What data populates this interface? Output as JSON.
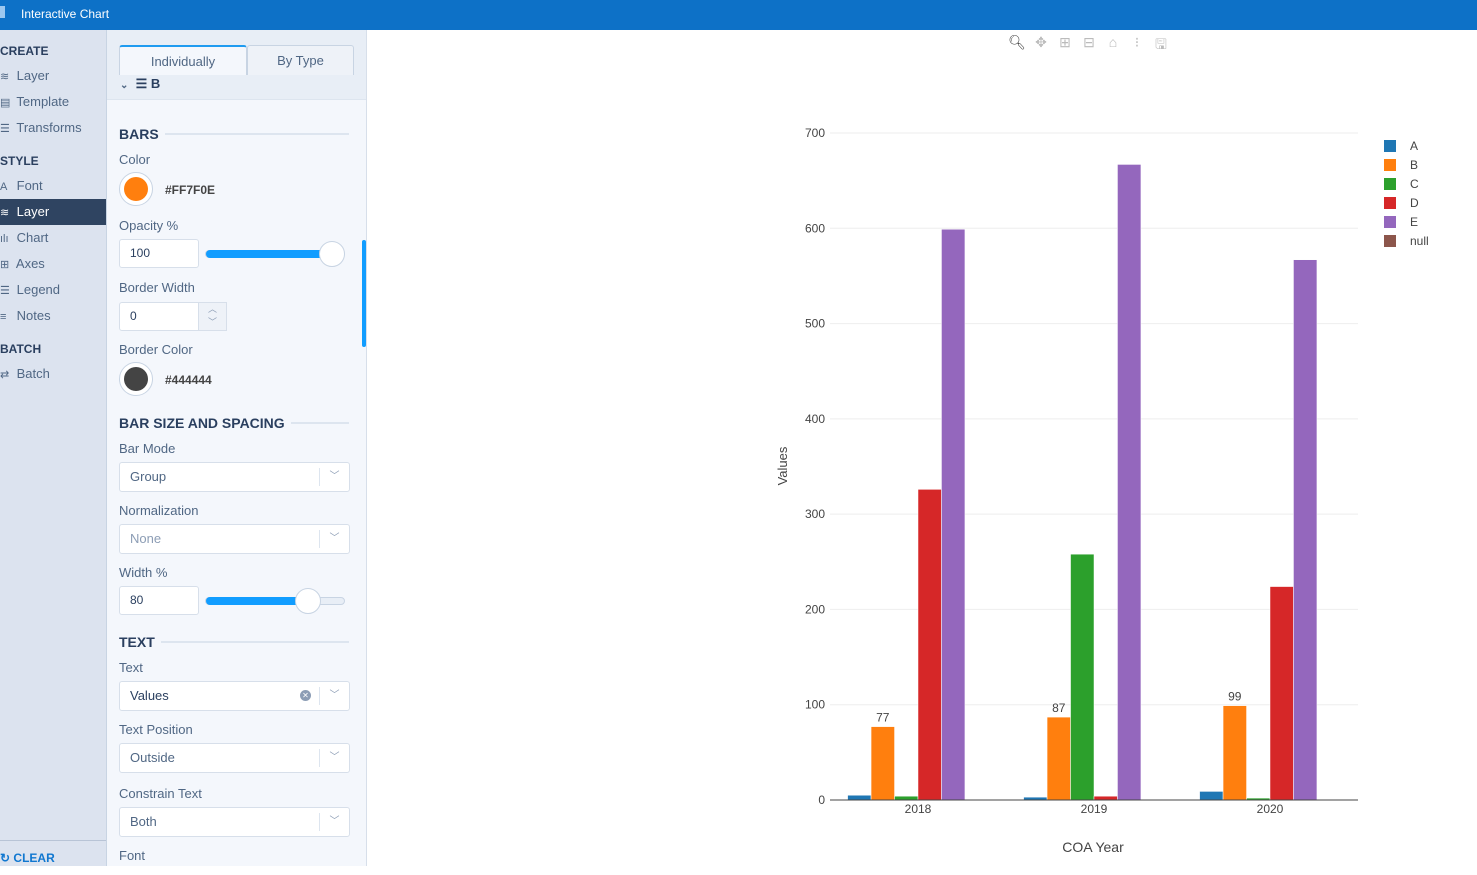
{
  "app": {
    "title": "Interactive Chart"
  },
  "nav": {
    "create_label": "CREATE",
    "style_label": "STYLE",
    "batch_label": "BATCH",
    "create": [
      {
        "label": "Layer"
      },
      {
        "label": "Template"
      },
      {
        "label": "Transforms"
      }
    ],
    "style": [
      {
        "label": "Font"
      },
      {
        "label": "Layer"
      },
      {
        "label": "Chart"
      },
      {
        "label": "Axes"
      },
      {
        "label": "Legend"
      },
      {
        "label": "Notes"
      }
    ],
    "batch": [
      {
        "label": "Batch"
      }
    ],
    "clear_label": "CLEAR"
  },
  "panel": {
    "tabs": [
      {
        "label": "Individually"
      },
      {
        "label": "By Type"
      }
    ],
    "trace_name": "B",
    "bars_section": "BARS",
    "color_label": "Color",
    "color_value": "#FF7F0E",
    "opacity_label": "Opacity %",
    "opacity_value": "100",
    "opacity_fraction": 1.0,
    "border_width_label": "Border Width",
    "border_width_value": "0",
    "border_color_label": "Border Color",
    "border_color_value": "#444444",
    "size_section": "BAR SIZE AND SPACING",
    "bar_mode_label": "Bar Mode",
    "bar_mode_value": "Group",
    "normalization_label": "Normalization",
    "normalization_value": "None",
    "width_label": "Width %",
    "width_value": "80",
    "width_fraction": 0.8,
    "text_section": "TEXT",
    "text_label": "Text",
    "text_value": "Values",
    "text_position_label": "Text Position",
    "text_position_value": "Outside",
    "constrain_label": "Constrain Text",
    "constrain_value": "Both",
    "font_label": "Font"
  },
  "chart_data": {
    "type": "bar",
    "categories": [
      "2018",
      "2019",
      "2020"
    ],
    "series": [
      {
        "name": "A",
        "color": "#1f77b4",
        "values": [
          5,
          3,
          9
        ]
      },
      {
        "name": "B",
        "color": "#ff7f0e",
        "values": [
          77,
          87,
          99
        ],
        "labels": [
          "77",
          "87",
          "99"
        ]
      },
      {
        "name": "C",
        "color": "#2ca02c",
        "values": [
          4,
          258,
          2
        ]
      },
      {
        "name": "D",
        "color": "#d62728",
        "values": [
          326,
          4,
          224
        ]
      },
      {
        "name": "E",
        "color": "#9467bd",
        "values": [
          599,
          667,
          567
        ]
      },
      {
        "name": "null",
        "color": "#8c564b",
        "values": []
      }
    ],
    "xlabel": "COA Year",
    "ylabel": "Values",
    "ylim": [
      0,
      700
    ],
    "yticks": [
      "0",
      "100",
      "200",
      "300",
      "400",
      "500",
      "600",
      "700"
    ],
    "grid": true,
    "legend": "top-right",
    "barmode": "group"
  }
}
